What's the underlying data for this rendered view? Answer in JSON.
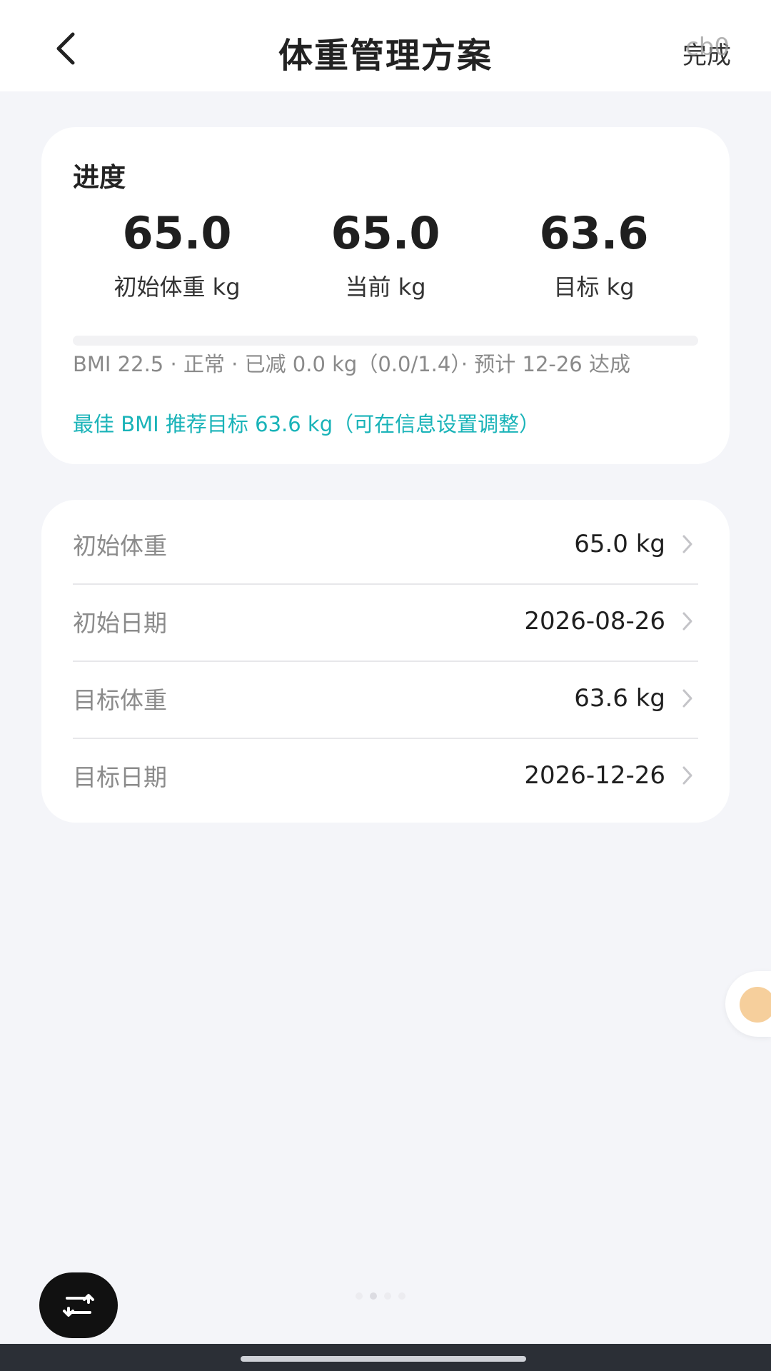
{
  "header": {
    "title": "体重管理方案",
    "done_label": "完成",
    "overlay_text": "cb0"
  },
  "progress": {
    "title": "进度",
    "stats": [
      {
        "value": "65.0",
        "label": "初始体重 kg"
      },
      {
        "value": "65.0",
        "label": "当前 kg"
      },
      {
        "value": "63.6",
        "label": "目标 kg"
      }
    ],
    "progress_percent": 0,
    "summary": "BMI 22.5 · 正常 · 已减 0.0 kg（0.0/1.4）· 预计 12-26 达成",
    "recommendation": "最佳 BMI 推荐目标 63.6 kg（可在信息设置调整）",
    "accent_color": "#19b3b8"
  },
  "info": {
    "rows": [
      {
        "label": "初始体重",
        "value": "65.0 kg"
      },
      {
        "label": "初始日期",
        "value": "2026-08-26"
      },
      {
        "label": "目标体重",
        "value": "63.6 kg"
      },
      {
        "label": "目标日期",
        "value": "2026-12-26"
      }
    ]
  },
  "icons": {
    "back": "chevron-left-icon",
    "row_chevron": "chevron-right-icon",
    "fab": "swap-icon"
  }
}
